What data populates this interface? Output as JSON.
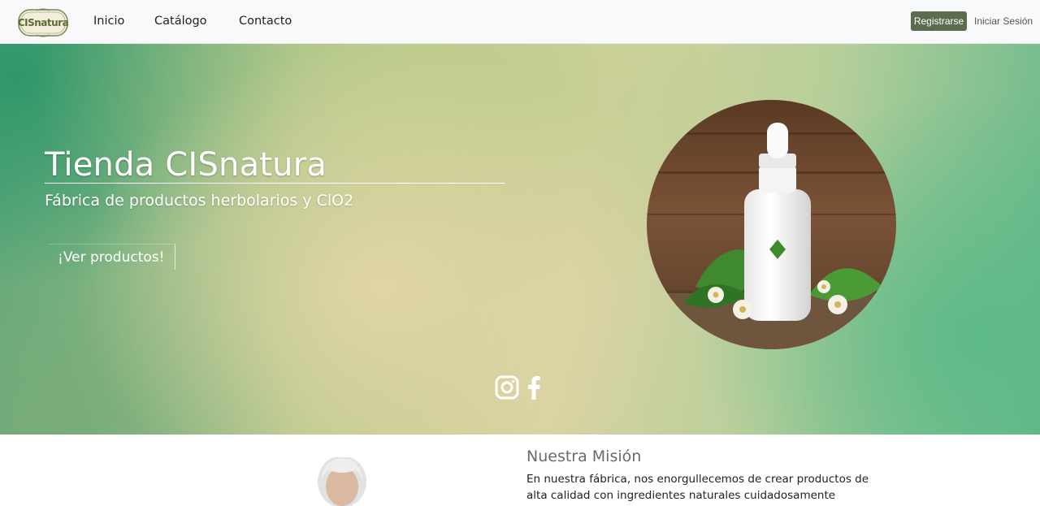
{
  "brand": {
    "logo_text": "CISnatura"
  },
  "nav": {
    "items": [
      {
        "label": "Inicio"
      },
      {
        "label": "Catálogo"
      },
      {
        "label": "Contacto"
      }
    ],
    "register_label": "Registrarse",
    "login_label": "Iniciar Sesión"
  },
  "hero": {
    "title": "Tienda CISnatura",
    "subtitle": "Fábrica de productos herbolarios y ClO2",
    "cta_label": "¡Ver productos!",
    "image_icon": "dropper-bottle-with-herbs-image",
    "social": [
      {
        "icon": "instagram-icon"
      },
      {
        "icon": "facebook-icon"
      }
    ]
  },
  "mission": {
    "title": "Nuestra Misión",
    "text": "En nuestra fábrica, nos enorgullecemos de crear productos de alta calidad con ingredientes naturales cuidadosamente"
  },
  "colors": {
    "brand_green": "#5d6b4f",
    "hero_green": "#2d9669",
    "hero_cream": "#e2d6a5"
  }
}
